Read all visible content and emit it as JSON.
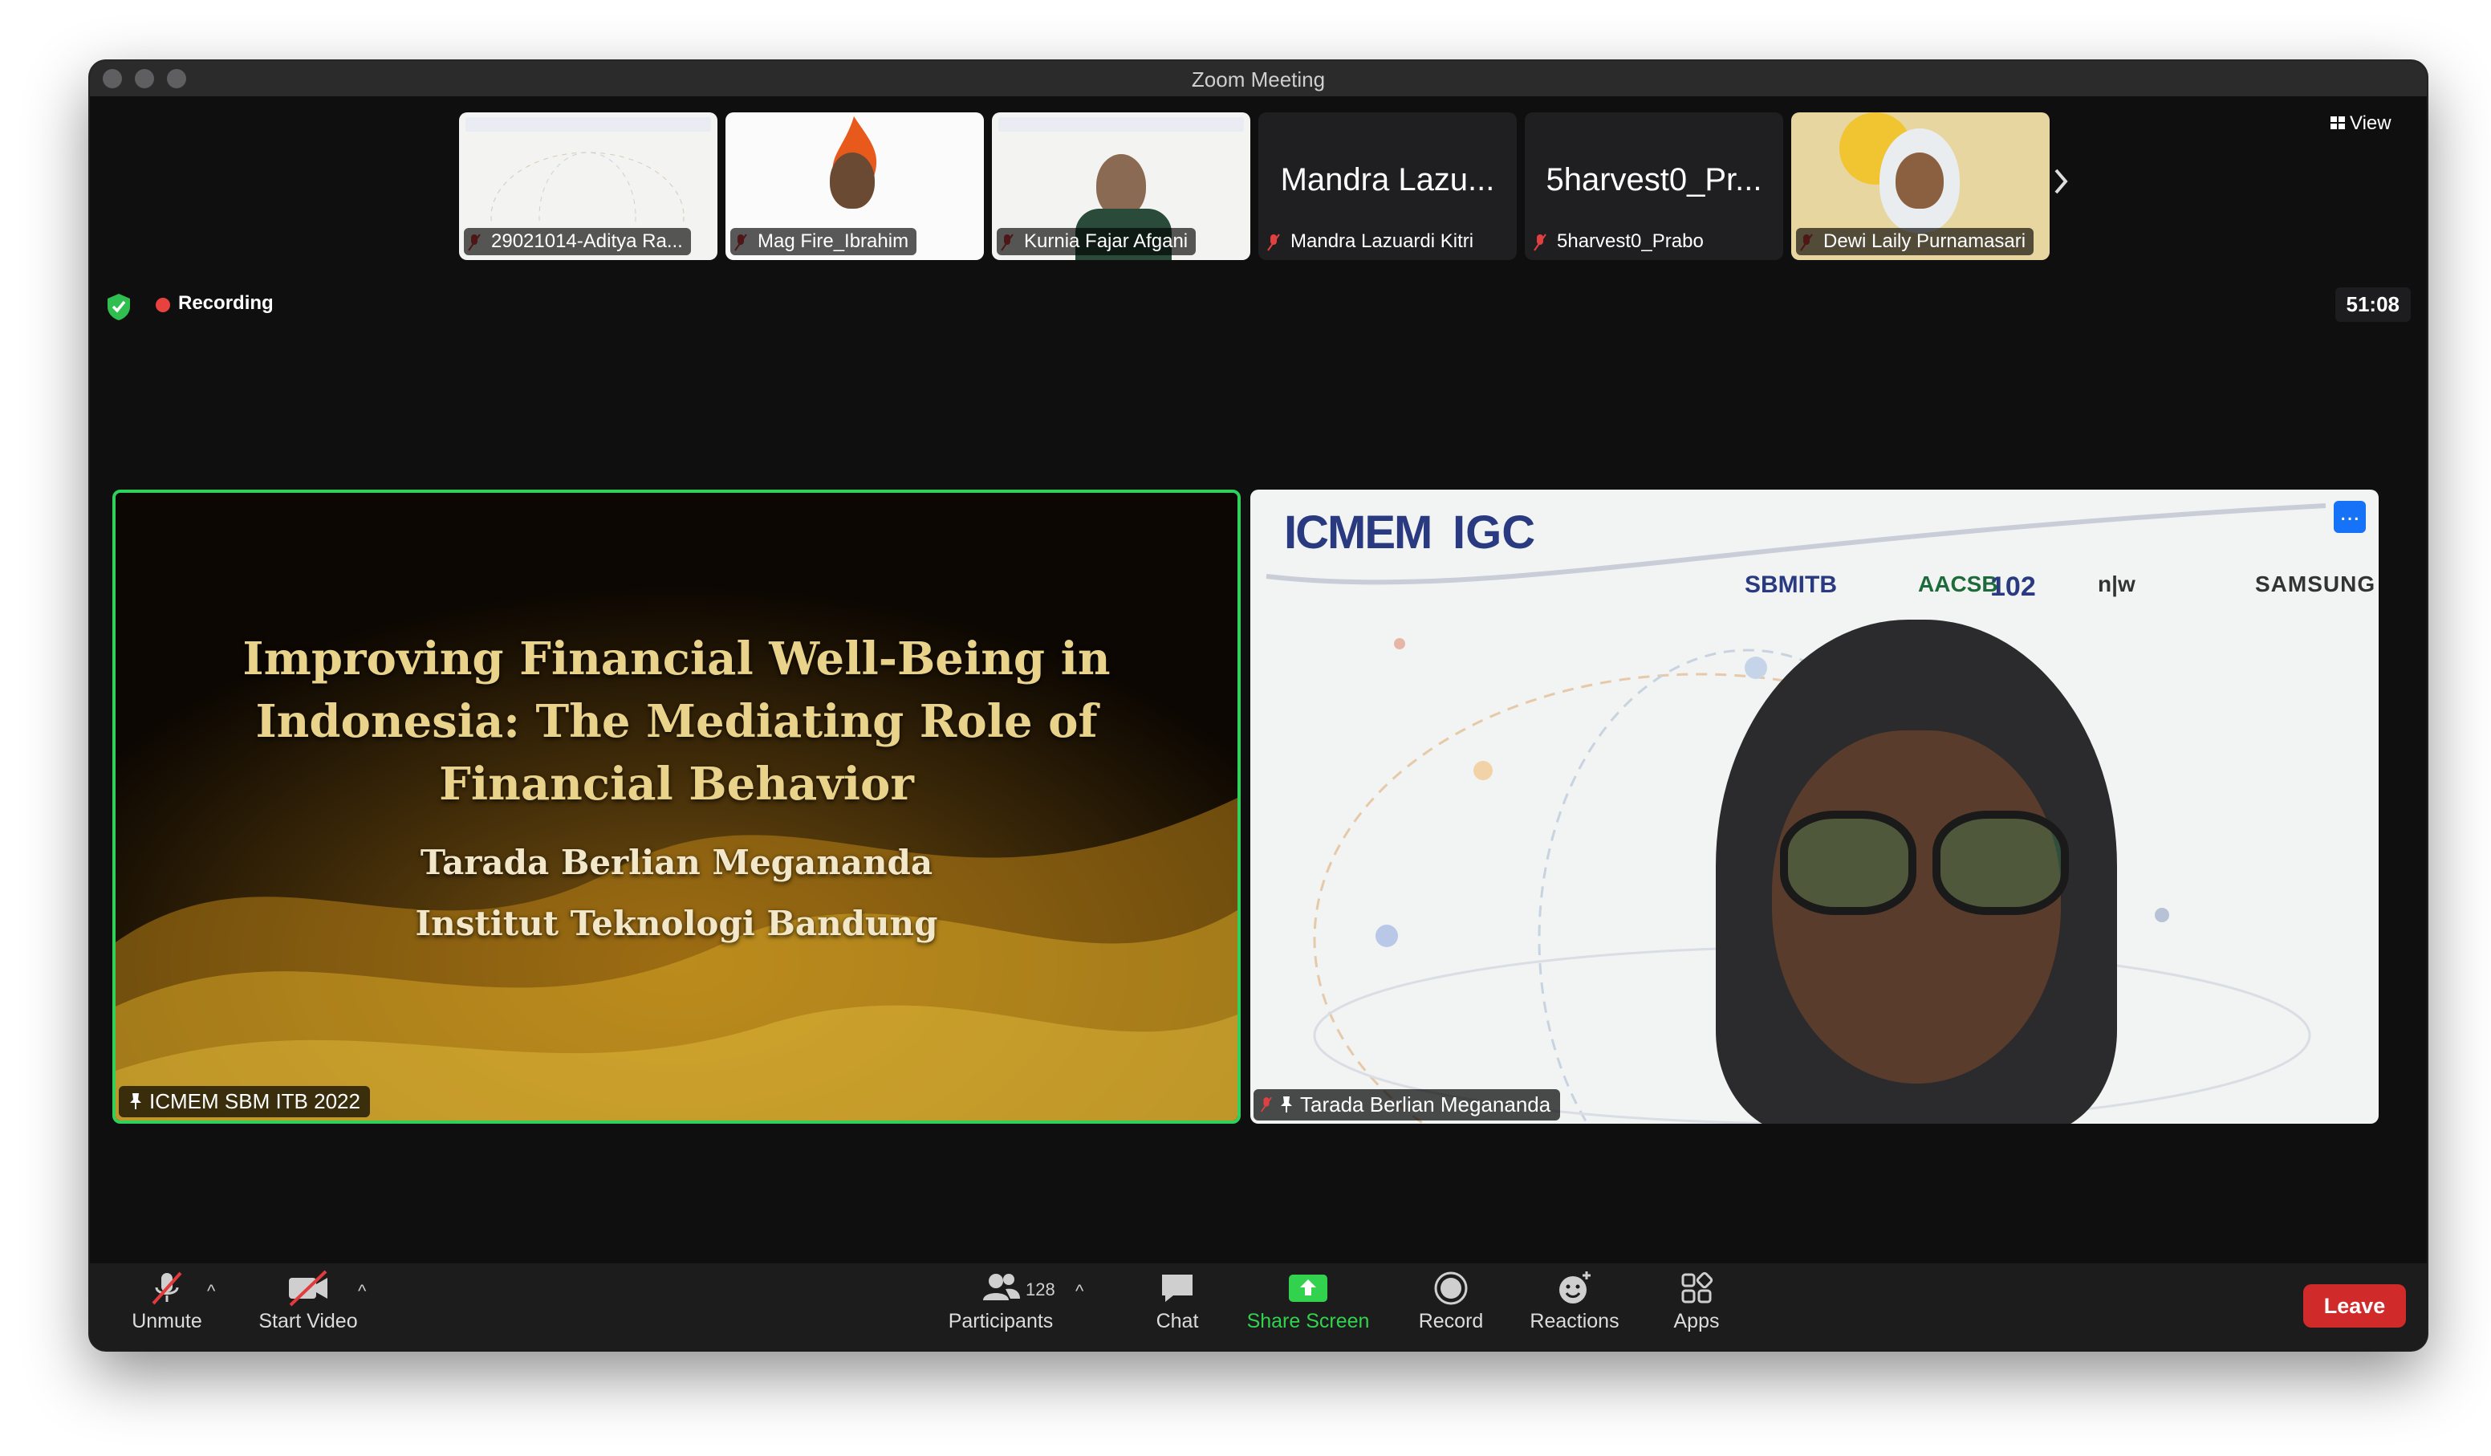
{
  "window": {
    "title": "Zoom Meeting"
  },
  "status": {
    "recording": "Recording",
    "timer": "51:08"
  },
  "view_button": {
    "label": "View"
  },
  "thumbnails": [
    {
      "name": "29021014-Aditya Ra...",
      "kind": "video"
    },
    {
      "name": "Mag Fire_Ibrahim",
      "kind": "video"
    },
    {
      "name": "Kurnia Fajar Afgani",
      "kind": "video"
    },
    {
      "name": "Mandra Lazuardi Kitri",
      "display": "Mandra Lazu...",
      "kind": "name"
    },
    {
      "name": "5harvest0_Prabo",
      "display": "5harvest0_Pr...",
      "kind": "name"
    },
    {
      "name": "Dewi Laily Purnamasari",
      "kind": "video"
    }
  ],
  "left_tile": {
    "title_lines": [
      "Improving Financial Well-Being in",
      "Indonesia: The Mediating Role of",
      "Financial Behavior"
    ],
    "author": "Tarada Berlian Meganandа",
    "institution": "Institut Teknologi Bandung",
    "label": "ICMEM SBM ITB 2022"
  },
  "right_tile": {
    "label": "Tarada Berlian Megananda",
    "logos": {
      "icmem": "ICMEM",
      "igc": "IGC",
      "sbm": "SBMITB",
      "aacsb": "AACSB",
      "anniversary": "102",
      "nw": "n|w",
      "samsung": "SAMSUNG"
    },
    "more_button": "..."
  },
  "toolbar": {
    "unmute": "Unmute",
    "start_video": "Start Video",
    "participants": "Participants",
    "participants_count": "128",
    "chat": "Chat",
    "share_screen": "Share Screen",
    "record": "Record",
    "reactions": "Reactions",
    "apps": "Apps",
    "leave": "Leave"
  },
  "colors": {
    "accent_green": "#32d24f",
    "leave_red": "#d02a2a",
    "active_speaker_border": "#2fd15a",
    "more_blue": "#1672f7"
  }
}
